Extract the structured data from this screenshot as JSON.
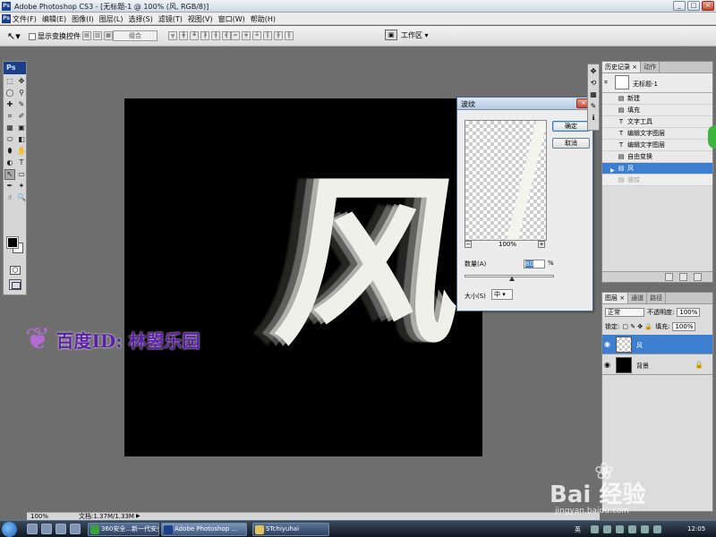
{
  "window": {
    "app_badge": "Ps",
    "title": "Adobe Photoshop CS3 - [无标题-1 @ 100% (风, RGB/8)]",
    "controls": [
      "_",
      "□",
      "×"
    ]
  },
  "menubar": {
    "items": [
      "文件(F)",
      "编辑(E)",
      "图像(I)",
      "图层(L)",
      "选择(S)",
      "滤镜(T)",
      "视图(V)",
      "窗口(W)",
      "帮助(H)"
    ]
  },
  "options": {
    "show_transform_label": "显示变换控件",
    "combine_label": "组合",
    "workspace_label": "工作区 ▾"
  },
  "tools": {
    "logo": "Ps",
    "icons": [
      "⬚",
      "✥",
      "◯",
      "⚲",
      "✚",
      "✎",
      "⌗",
      "✐",
      "▦",
      "▣",
      "⬭",
      "◧",
      "⬮",
      "✋",
      "◐",
      "✦",
      "T",
      "↖",
      "▭",
      "✒",
      "☝",
      "🔍"
    ]
  },
  "canvas": {
    "glyph": "风"
  },
  "watermark": {
    "text": "百度ID: 林曌乐园",
    "icon": "butterfly-icon"
  },
  "dialog": {
    "title": "波纹",
    "ok": "确定",
    "cancel": "取消",
    "zoom_minus": "−",
    "zoom_pct": "100%",
    "zoom_plus": "+",
    "amount_label": "数量(A)",
    "amount_value": "80",
    "amount_unit": "%",
    "size_label": "大小(S)",
    "size_value": "中 ▾"
  },
  "history": {
    "tabs": [
      "历史记录 ×",
      "动作"
    ],
    "snapshot": "无标题-1",
    "items": [
      {
        "icon": "▤",
        "label": "新建"
      },
      {
        "icon": "▤",
        "label": "填充"
      },
      {
        "icon": "T",
        "label": "文字工具"
      },
      {
        "icon": "T",
        "label": "编辑文字图层"
      },
      {
        "icon": "T",
        "label": "编辑文字图层"
      },
      {
        "icon": "▤",
        "label": "自由变换"
      },
      {
        "icon": "▤",
        "label": "风"
      },
      {
        "icon": "▤",
        "label": "波纹"
      }
    ]
  },
  "layers": {
    "tabs": [
      "图层 ×",
      "通道",
      "路径"
    ],
    "blend_mode": "正常",
    "opacity_label": "不透明度:",
    "opacity_value": "100%",
    "lock_label": "锁定:",
    "fill_label": "填充:",
    "fill_value": "100%",
    "list": [
      {
        "name": "风"
      },
      {
        "name": "背景"
      }
    ]
  },
  "status": {
    "zoom": "100%",
    "doc": "文档:1.37M/1.33M"
  },
  "taskbar": {
    "tasks": [
      {
        "label": "360安全...新一代安全..."
      },
      {
        "label": "Adobe Photoshop ..."
      },
      {
        "label": "STchiyuhai"
      }
    ],
    "ime": "英",
    "time": "12:05"
  },
  "brand_watermark": {
    "name": "Bai 经验",
    "url": "jingyan.baidu.com"
  },
  "colors": {
    "selection_blue": "#3c7ed0",
    "canvas_bg": "#000000",
    "glyph_color": "#f0f0ea",
    "watermark_purple": "#5b1fa8"
  }
}
